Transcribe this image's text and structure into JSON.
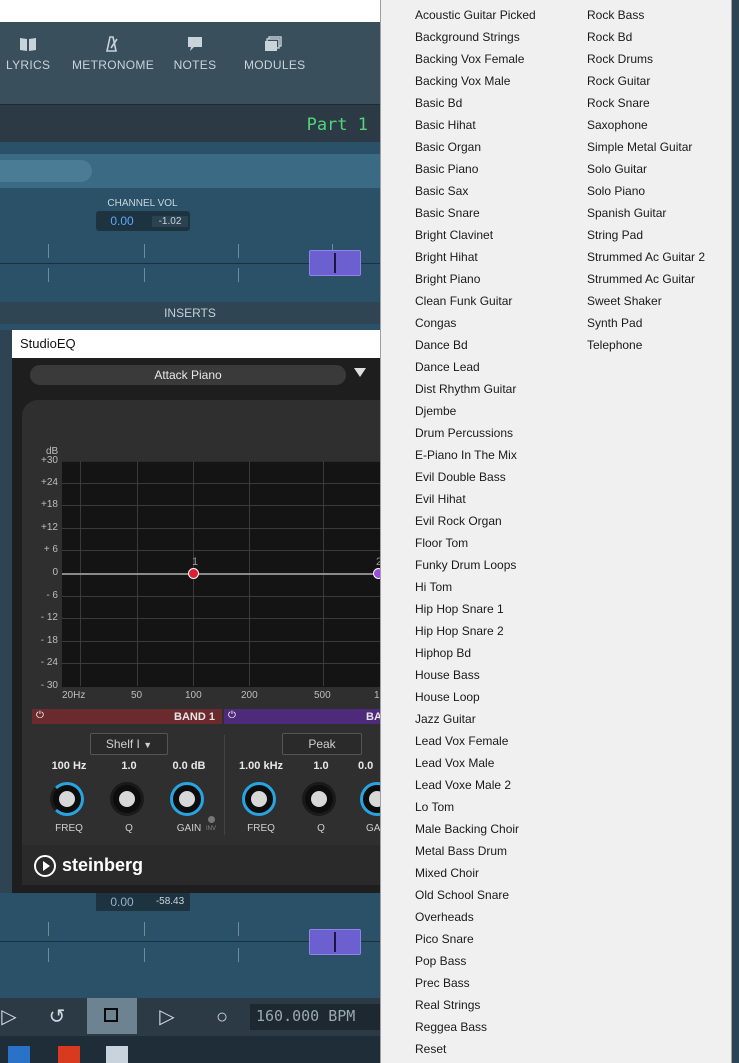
{
  "toolbar": {
    "items": [
      {
        "label": "LYRICS",
        "icon": "book-icon"
      },
      {
        "label": "METRONOME",
        "icon": "metronome-icon"
      },
      {
        "label": "NOTES",
        "icon": "speech-bubble-icon"
      },
      {
        "label": "MODULES",
        "icon": "stack-icon"
      }
    ]
  },
  "part": {
    "label": "Part 1"
  },
  "mixer": {
    "channel_vol_label": "CHANNEL VOL",
    "channel_vol_value": "0.00",
    "channel_vol_db": "-1.02",
    "inserts_label": "INSERTS",
    "lower_vol_value": "0.00",
    "lower_vol_db": "-58.43"
  },
  "eq": {
    "window_title": "StudioEQ",
    "preset": "Attack Piano",
    "db_label": "dB",
    "y_ticks": [
      "+30",
      "+24",
      "+18",
      "+12",
      "+ 6",
      "0",
      "- 6",
      "- 12",
      "- 18",
      "- 24",
      "- 30"
    ],
    "x_ticks": [
      "20Hz",
      "50",
      "100",
      "200",
      "500",
      "1"
    ],
    "node_labels": [
      "1",
      "2"
    ],
    "band1": {
      "label": "BAND 1",
      "type": "Shelf I",
      "freq": "100 Hz",
      "q": "1.0",
      "gain": "0.0 dB",
      "inv": "INV"
    },
    "band2": {
      "label": "BA",
      "type": "Peak",
      "freq": "1.00 kHz",
      "q": "1.0",
      "gain": "0.0"
    },
    "knob_labels": {
      "freq": "FREQ",
      "q": "Q",
      "gain": "GAIN",
      "gain_cut": "GA"
    },
    "brand": "steinberg"
  },
  "transport": {
    "bpm": "160.000 BPM"
  },
  "menu": {
    "col1": [
      "Acoustic Guitar Picked",
      "Background Strings",
      "Backing Vox Female",
      "Backing Vox Male",
      "Basic Bd",
      "Basic Hihat",
      "Basic Organ",
      "Basic Piano",
      "Basic Sax",
      "Basic Snare",
      "Bright Clavinet",
      "Bright Hihat",
      "Bright Piano",
      "Clean Funk Guitar",
      "Congas",
      "Dance Bd",
      "Dance Lead",
      "Dist Rhythm Guitar",
      "Djembe",
      "Drum Percussions",
      "E-Piano In The Mix",
      "Evil Double Bass",
      "Evil Hihat",
      "Evil Rock Organ",
      "Floor Tom",
      "Funky Drum Loops",
      "Hi Tom",
      "Hip Hop Snare 1",
      "Hip Hop Snare 2",
      "Hiphop Bd",
      "House Bass",
      "House Loop",
      "Jazz Guitar",
      "Lead Vox Female",
      "Lead Vox Male",
      "Lead Voxe Male 2",
      "Lo Tom",
      "Male Backing Choir",
      "Metal Bass Drum",
      "Mixed Choir",
      "Old School Snare",
      "Overheads",
      "Pico Snare",
      "Pop Bass",
      "Prec Bass",
      "Real Strings",
      "Reggea Bass",
      "Reset"
    ],
    "col2": [
      "Rock Bass",
      "Rock Bd",
      "Rock Drums",
      "Rock Guitar",
      "Rock Snare",
      "Saxophone",
      "Simple Metal Guitar",
      "Solo Guitar",
      "Solo Piano",
      "Spanish Guitar",
      "String Pad",
      "Strummed Ac Guitar 2",
      "Strummed Ac Guitar",
      "Sweet Shaker",
      "Synth Pad",
      "Telephone"
    ]
  }
}
